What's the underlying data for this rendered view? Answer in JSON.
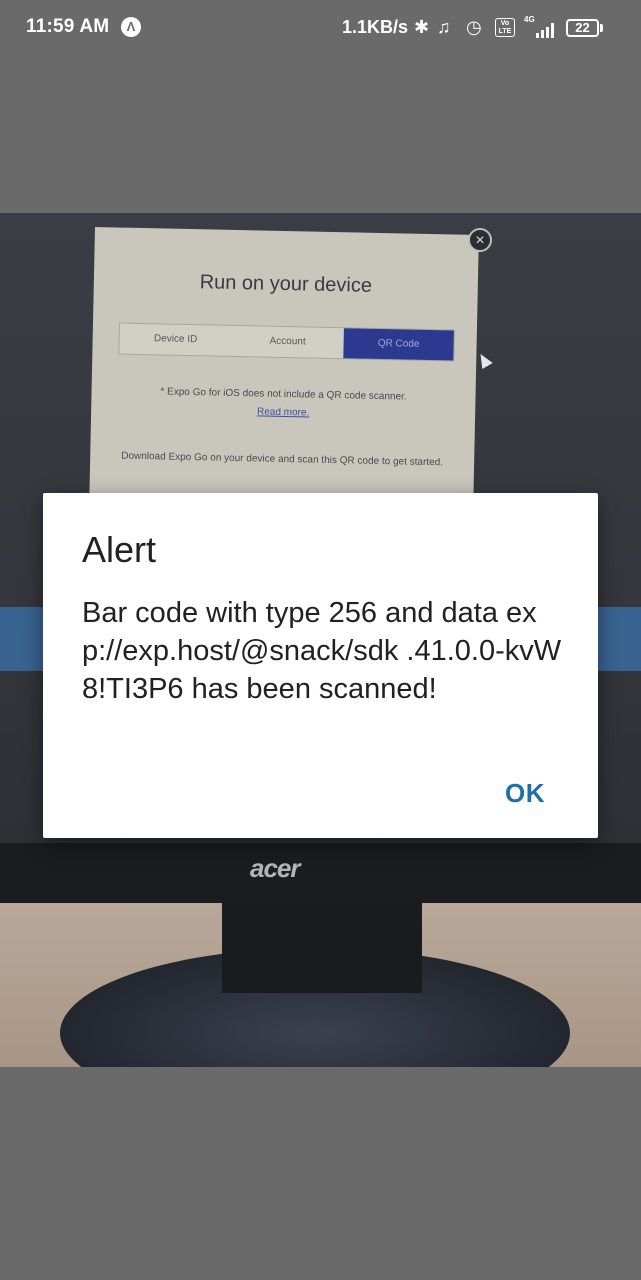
{
  "status_bar": {
    "time": "11:59 AM",
    "app_badge": "Λ",
    "net_speed": "1.1KB/s",
    "icons": [
      "bluetooth-icon",
      "mute-icon",
      "alarm-icon",
      "volte-icon",
      "signal-icon",
      "battery-icon"
    ],
    "volte": "Vo LTE",
    "network": "4G",
    "battery": "22"
  },
  "camera_preview": {
    "expo_dialog": {
      "title": "Run on your device",
      "tabs": [
        {
          "label": "Device ID"
        },
        {
          "label": "Account"
        },
        {
          "label": "QR Code"
        }
      ],
      "note": "* Expo Go for iOS does not include a QR code scanner.",
      "link": "Read more.",
      "description": "Download Expo Go on your device and scan this QR code to get started.",
      "close_glyph": "×"
    },
    "monitor_brand": "acer"
  },
  "alert": {
    "title": "Alert",
    "message": "Bar code with type 256 and data exp://exp.host/@snack/sdk .41.0.0-kvW8!TI3P6 has been scanned!",
    "ok_label": "OK"
  },
  "colors": {
    "backdrop": "#6a6a6a",
    "alert_bg": "#ffffff",
    "ok_button": "#1f6fa8"
  }
}
